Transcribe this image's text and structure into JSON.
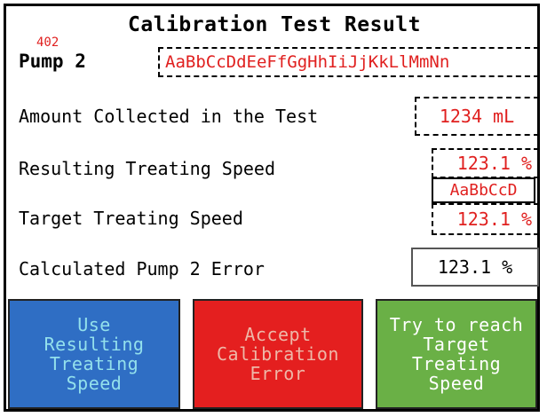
{
  "title": "Calibration Test Result",
  "pump": {
    "code": "402",
    "label": "Pump 2",
    "name_value": "AaBbCcDdEeFfGgHhIiJjKkLlMmNn"
  },
  "rows": {
    "amount_label": "Amount Collected in the Test",
    "amount_value": "1234 mL",
    "resulting_label": "Resulting Treating Speed",
    "resulting_value": "123.1 %",
    "resulting_unit_field": "AaBbCcD",
    "target_label": "Target Treating Speed",
    "target_value": "123.1 %",
    "error_label": "Calculated Pump 2 Error",
    "error_value": "123.1 %"
  },
  "buttons": {
    "use_resulting": "Use\nResulting\nTreating\nSpeed",
    "accept_error": "Accept\nCalibration\nError",
    "try_target": "Try to reach\nTarget\nTreating\nSpeed"
  },
  "colors": {
    "value_red": "#e0201f",
    "button_blue": "#2f6ec4",
    "button_red": "#e41f1f",
    "button_green": "#6ab046"
  }
}
